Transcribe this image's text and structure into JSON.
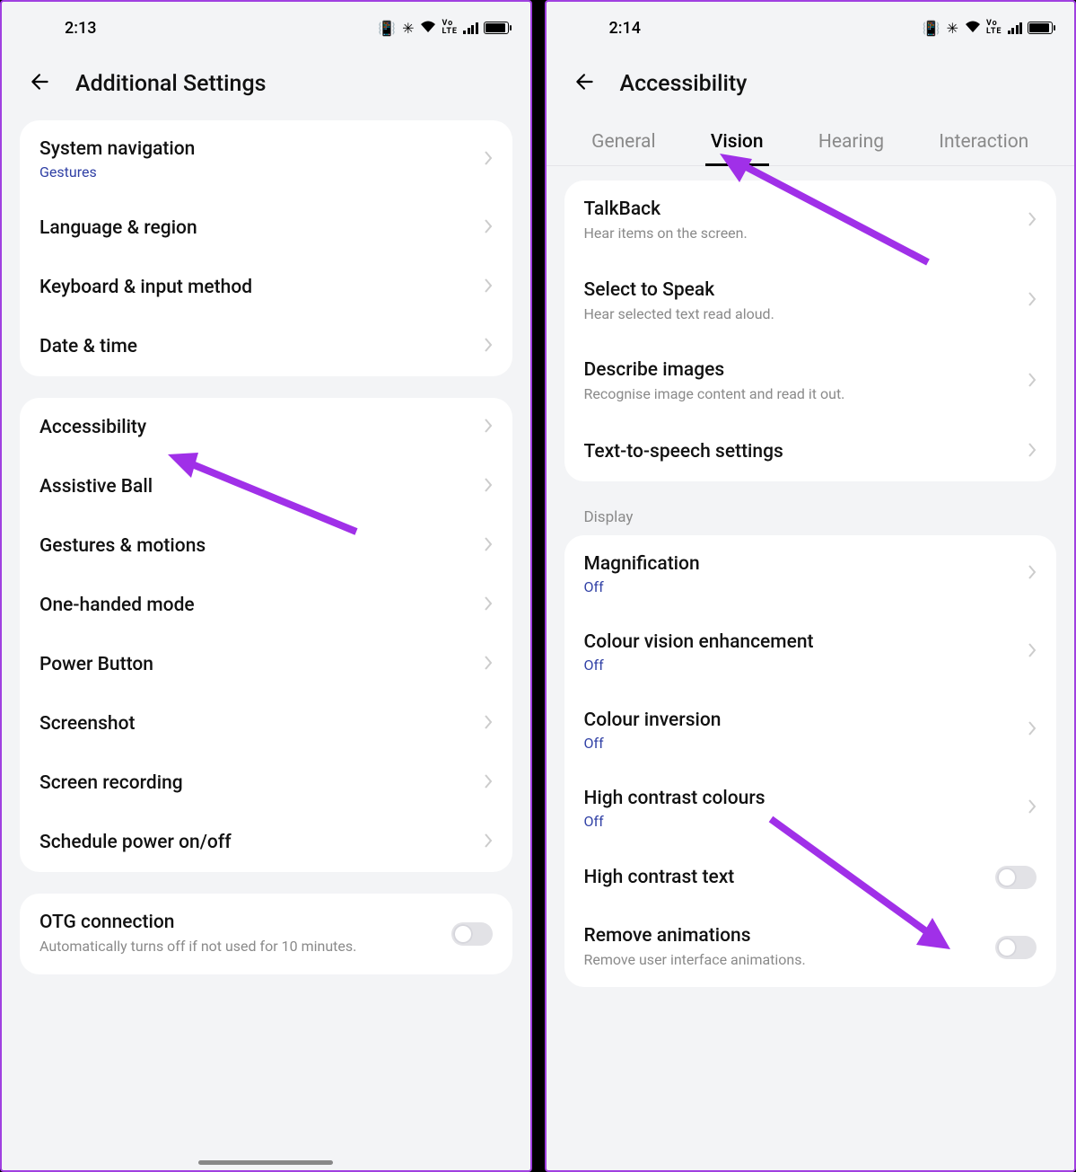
{
  "left": {
    "status_time": "2:13",
    "header_title": "Additional Settings",
    "group1": [
      {
        "title": "System navigation",
        "sub": "Gestures"
      },
      {
        "title": "Language & region"
      },
      {
        "title": "Keyboard & input method"
      },
      {
        "title": "Date & time"
      }
    ],
    "group2": [
      {
        "title": "Accessibility"
      },
      {
        "title": "Assistive Ball"
      },
      {
        "title": "Gestures & motions"
      },
      {
        "title": "One-handed mode"
      },
      {
        "title": "Power Button"
      },
      {
        "title": "Screenshot"
      },
      {
        "title": "Screen recording"
      },
      {
        "title": "Schedule power on/off"
      }
    ],
    "group3": [
      {
        "title": "OTG connection",
        "desc": "Automatically turns off if not used for 10 minutes."
      }
    ]
  },
  "right": {
    "status_time": "2:14",
    "header_title": "Accessibility",
    "tabs": [
      "General",
      "Vision",
      "Hearing",
      "Interaction"
    ],
    "active_tab": "Vision",
    "group1": [
      {
        "title": "TalkBack",
        "desc": "Hear items on the screen."
      },
      {
        "title": "Select to Speak",
        "desc": "Hear selected text read aloud."
      },
      {
        "title": "Describe images",
        "desc": "Recognise image content and read it out."
      },
      {
        "title": "Text-to-speech settings"
      }
    ],
    "section_display": "Display",
    "group2": [
      {
        "title": "Magnification",
        "sub": "Off"
      },
      {
        "title": "Colour vision enhancement",
        "sub": "Off"
      },
      {
        "title": "Colour inversion",
        "sub": "Off"
      },
      {
        "title": "High contrast colours",
        "sub": "Off"
      },
      {
        "title": "High contrast text",
        "toggle": true
      },
      {
        "title": "Remove animations",
        "desc": "Remove user interface animations.",
        "toggle": true
      }
    ]
  },
  "status_volte": "Vo LTE"
}
